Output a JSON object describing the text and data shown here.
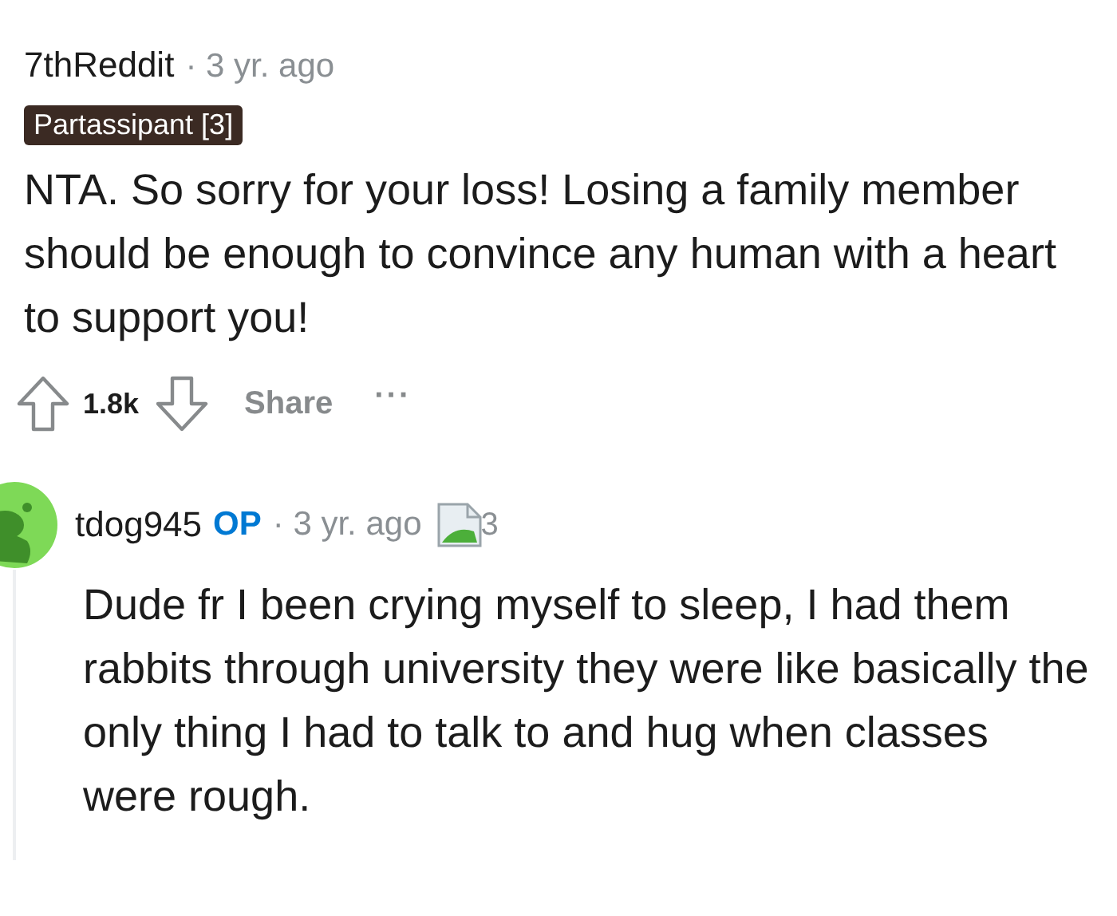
{
  "comment": {
    "author": "7thReddit",
    "time": "· 3 yr. ago",
    "flair": "Partassipant [3]",
    "body": "NTA. So sorry for your loss! Losing a family member should be enough to convince any human with a heart to support you!",
    "score": "1.8k",
    "share": "Share",
    "more": "···",
    "children": [
      {
        "author": "tdog945",
        "badge": "OP",
        "time": "· 3 yr. ago",
        "avatar": true,
        "image_count": "3",
        "body": "Dude fr I been crying myself to sleep, I had them rabbits through university they were like basically the only thing I had to talk to and hug when classes were rough."
      }
    ]
  }
}
